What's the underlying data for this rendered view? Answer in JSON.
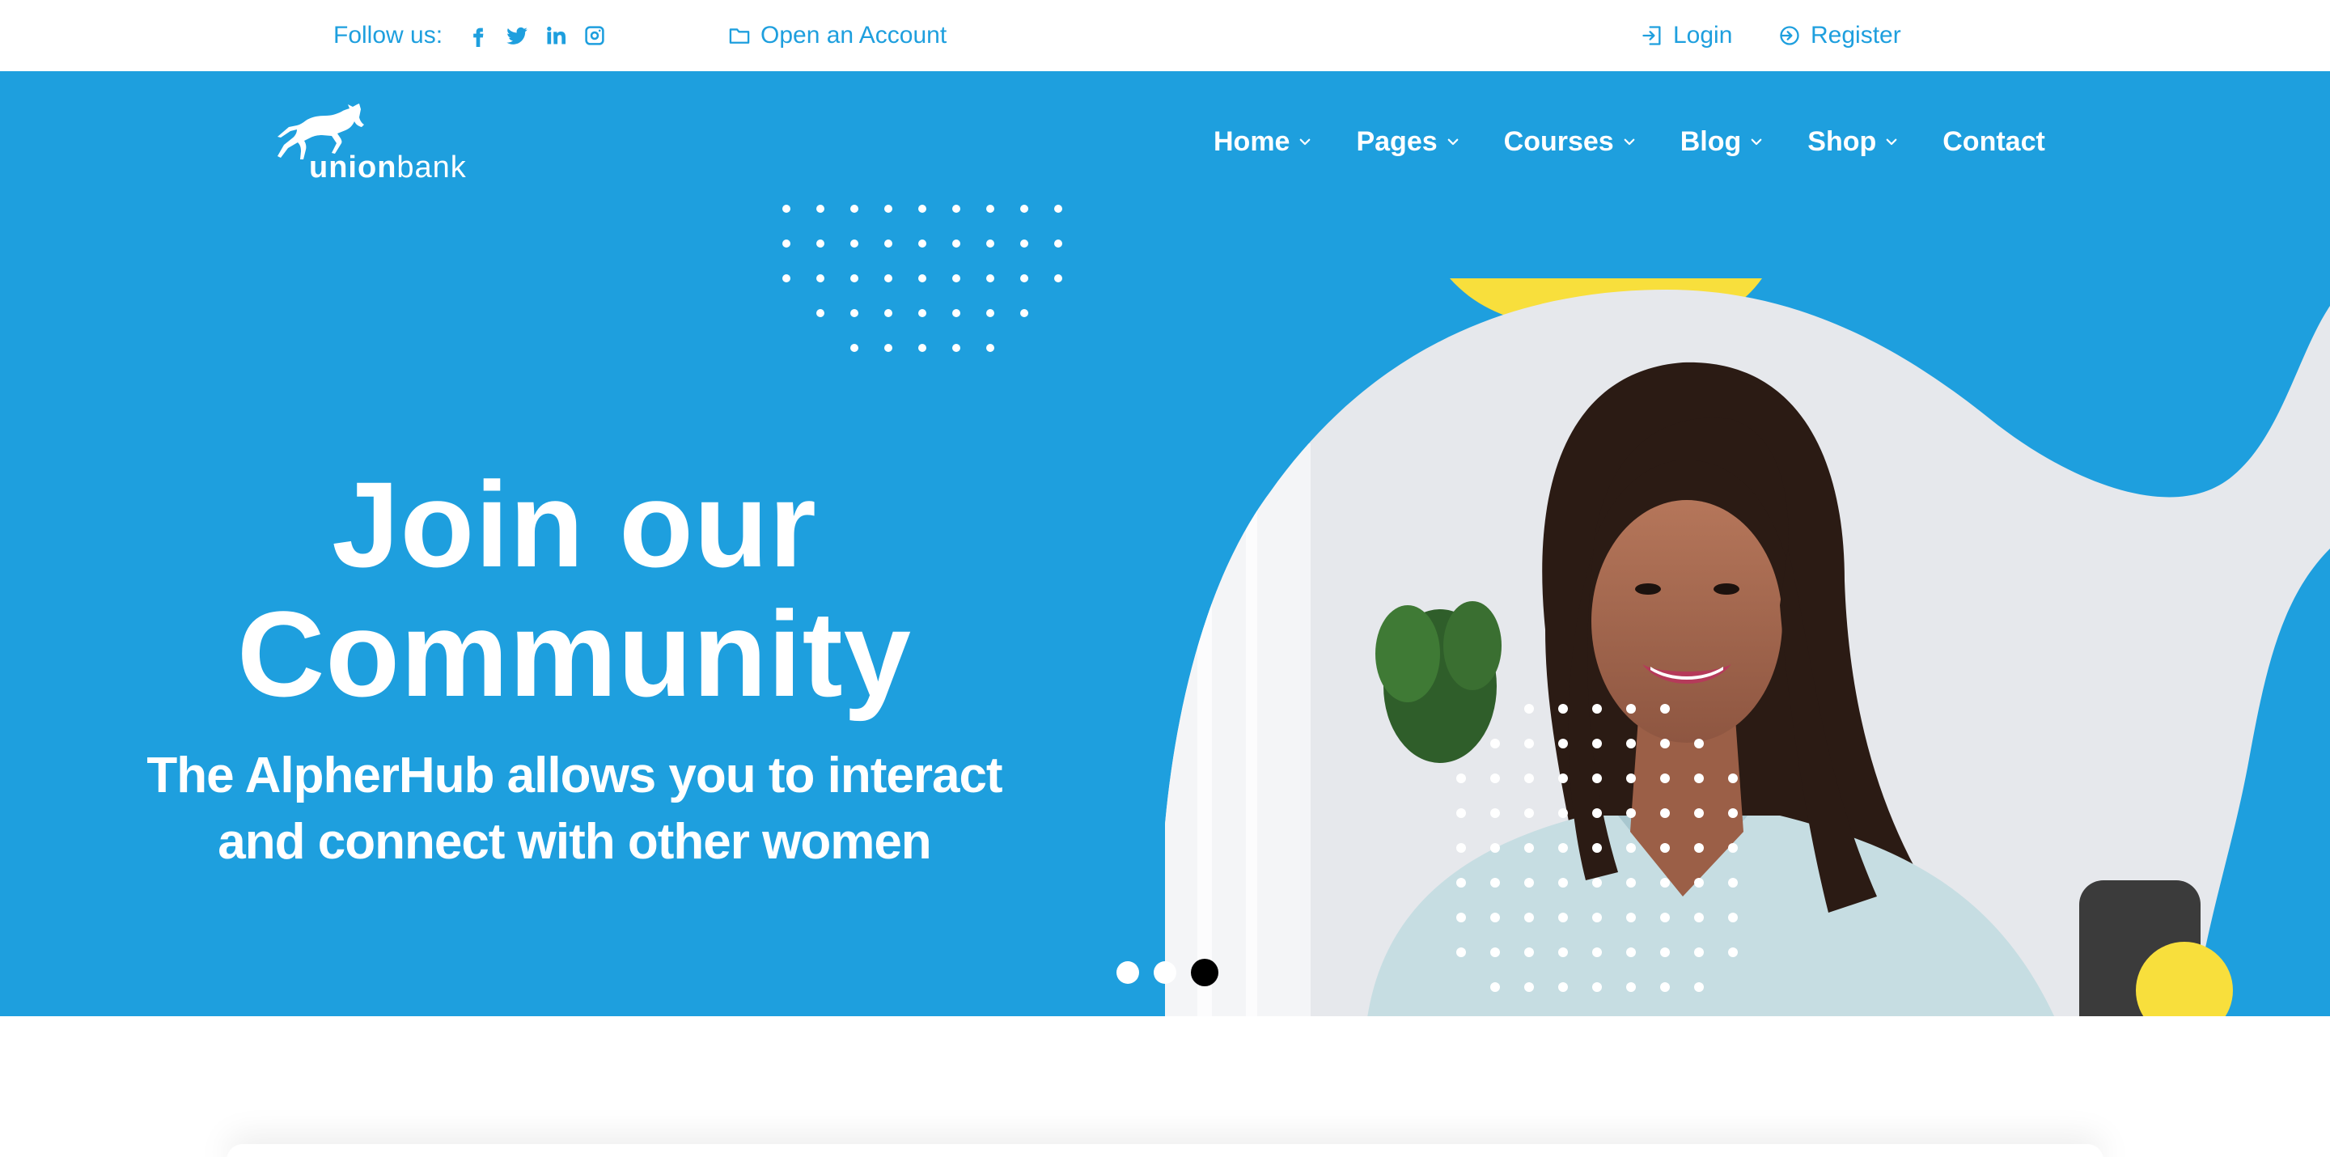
{
  "topbar": {
    "follow_label": "Follow us:",
    "social_icons": [
      "facebook-icon",
      "twitter-icon",
      "linkedin-icon",
      "instagram-icon"
    ],
    "open_account": "Open an Account",
    "login": "Login",
    "register": "Register"
  },
  "brand": {
    "name_bold": "union",
    "name_light": "bank",
    "logo_icon": "horse-icon"
  },
  "nav": {
    "items": [
      {
        "label": "Home",
        "dropdown": true
      },
      {
        "label": "Pages",
        "dropdown": true
      },
      {
        "label": "Courses",
        "dropdown": true
      },
      {
        "label": "Blog",
        "dropdown": true
      },
      {
        "label": "Shop",
        "dropdown": true
      },
      {
        "label": "Contact",
        "dropdown": false
      }
    ]
  },
  "hero": {
    "title_line1": "Join our",
    "title_line2": "Community",
    "subtitle_line1": "The AlpherHub allows you to interact",
    "subtitle_line2": "and connect with other women",
    "photo_alt": "smiling-woman-photo"
  },
  "carousel": {
    "slide_count": 3,
    "active_index": 2
  },
  "colors": {
    "primary_blue": "#1e9fde",
    "accent_yellow": "#f8df3c",
    "white": "#ffffff",
    "active_dot": "#000000"
  }
}
